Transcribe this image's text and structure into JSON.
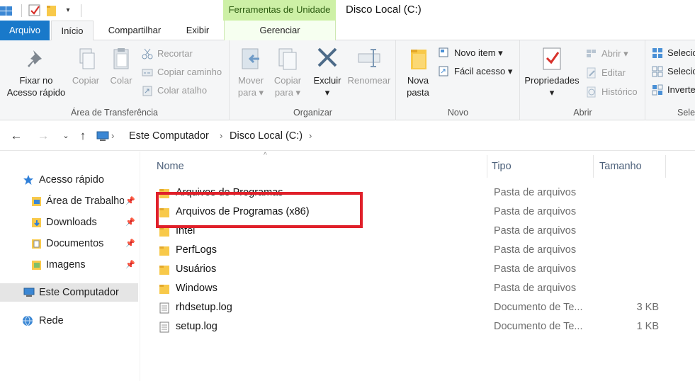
{
  "titlebar": {
    "context_tab": "Ferramentas de Unidade",
    "window_title": "Disco Local (C:)"
  },
  "tabs": {
    "file": "Arquivo",
    "home": "Início",
    "share": "Compartilhar",
    "view": "Exibir",
    "manage": "Gerenciar"
  },
  "ribbon": {
    "clipboard": {
      "label": "Área de Transferência",
      "pin_line1": "Fixar no",
      "pin_line2": "Acesso rápido",
      "copy": "Copiar",
      "paste": "Colar",
      "cut": "Recortar",
      "copy_path": "Copiar caminho",
      "paste_shortcut": "Colar atalho"
    },
    "organize": {
      "label": "Organizar",
      "move_line1": "Mover",
      "move_line2": "para",
      "copyto_line1": "Copiar",
      "copyto_line2": "para",
      "delete": "Excluir",
      "rename": "Renomear"
    },
    "new": {
      "label": "Novo",
      "new_folder_line1": "Nova",
      "new_folder_line2": "pasta",
      "new_item": "Novo item",
      "easy_access": "Fácil acesso"
    },
    "open": {
      "label": "Abrir",
      "properties": "Propriedades",
      "open": "Abrir",
      "edit": "Editar",
      "history": "Histórico"
    },
    "select": {
      "label": "Sele",
      "select_all": "Selecio",
      "select_none": "Selecio",
      "invert": "Inverte"
    }
  },
  "address": {
    "crumb1": "Este Computador",
    "crumb2": "Disco Local (C:)"
  },
  "nav": {
    "quick_access": "Acesso rápido",
    "desktop": "Área de Trabalho",
    "downloads": "Downloads",
    "documents": "Documentos",
    "pictures": "Imagens",
    "this_pc": "Este Computador",
    "network": "Rede"
  },
  "columns": {
    "name": "Nome",
    "type": "Tipo",
    "size": "Tamanho"
  },
  "files": [
    {
      "name": "Arquivos de Programas",
      "type": "Pasta de arquivos",
      "size": "",
      "icon": "folder-icon"
    },
    {
      "name": "Arquivos de Programas (x86)",
      "type": "Pasta de arquivos",
      "size": "",
      "icon": "folder-icon"
    },
    {
      "name": "Intel",
      "type": "Pasta de arquivos",
      "size": "",
      "icon": "folder-icon"
    },
    {
      "name": "PerfLogs",
      "type": "Pasta de arquivos",
      "size": "",
      "icon": "folder-icon"
    },
    {
      "name": "Usuários",
      "type": "Pasta de arquivos",
      "size": "",
      "icon": "folder-icon"
    },
    {
      "name": "Windows",
      "type": "Pasta de arquivos",
      "size": "",
      "icon": "folder-icon"
    },
    {
      "name": "rhdsetup.log",
      "type": "Documento de Te...",
      "size": "3 KB",
      "icon": "text-file-icon"
    },
    {
      "name": "setup.log",
      "type": "Documento de Te...",
      "size": "1 KB",
      "icon": "text-file-icon"
    }
  ],
  "colors": {
    "accent": "#1979ca",
    "context_tab": "#cdf0a6",
    "highlight": "#e0202a",
    "folder": "#f8c94a"
  }
}
